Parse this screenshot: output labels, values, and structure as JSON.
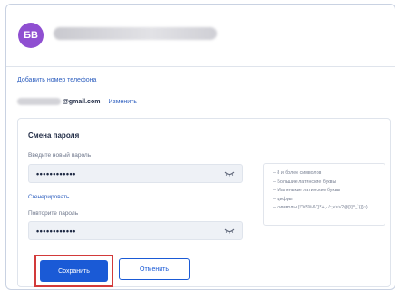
{
  "profile": {
    "avatar_initials": "БВ",
    "avatar_color": "#8f4fd1"
  },
  "contact": {
    "add_phone_label": "Добавить номер телефона",
    "email_domain": "@gmail.com",
    "change_label": "Изменить"
  },
  "password_form": {
    "title": "Смена пароля",
    "new_password_label": "Введите новый пароль",
    "new_password_value": "••••••••••••",
    "generate_label": "Сгенерировать",
    "repeat_password_label": "Повторите пароль",
    "repeat_password_value": "••••••••••••",
    "requirements": [
      "8 и более символов",
      "Большие латинские буквы",
      "Маленькие латинские буквы",
      "цифры",
      "символы (!\"#$%&'()*+,-./:;<=>?@[\\]^_`{|}~)"
    ],
    "save_label": "Сохранить",
    "cancel_label": "Отменить"
  },
  "colors": {
    "primary": "#1a5ad6",
    "highlight_border": "#d23a3a",
    "link": "#2e5fbf"
  }
}
